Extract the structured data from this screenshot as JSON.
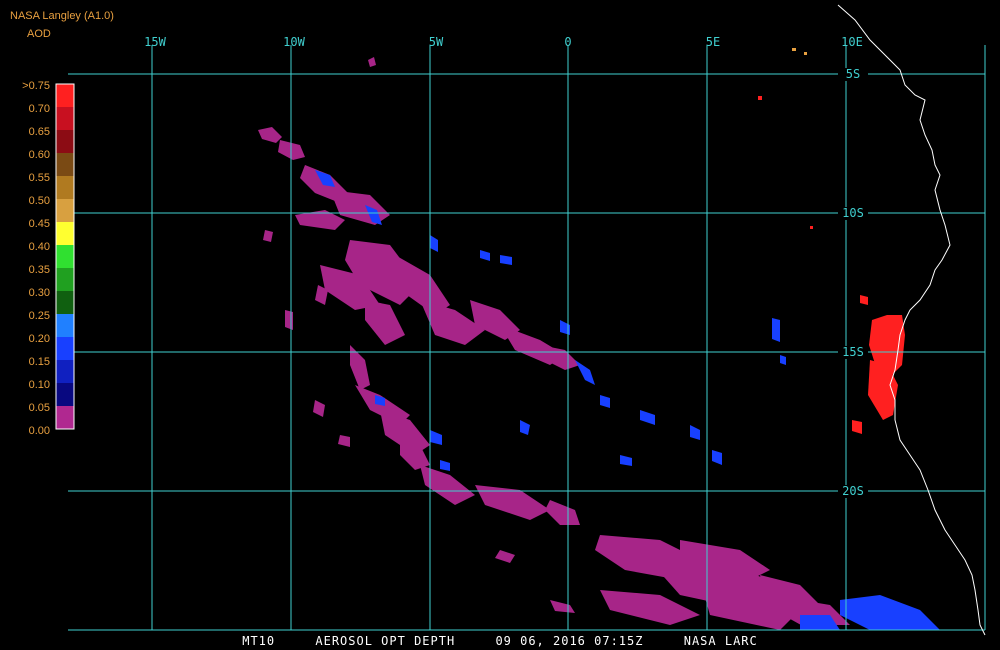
{
  "header": {
    "source": "NASA Langley (A1.0)",
    "product": "AOD"
  },
  "colorbar": {
    "labels": [
      ">0.75",
      "0.70",
      "0.65",
      "0.60",
      "0.55",
      "0.50",
      "0.45",
      "0.40",
      "0.35",
      "0.30",
      "0.25",
      "0.20",
      "0.15",
      "0.10",
      "0.05",
      "0.00"
    ],
    "colors": [
      "#ff2020",
      "#c81020",
      "#8c0c14",
      "#7a4a14",
      "#b07a20",
      "#d8a040",
      "#ffff30",
      "#30e030",
      "#20a020",
      "#106010",
      "#2080ff",
      "#1840ff",
      "#1020c0",
      "#080880",
      "#b02890"
    ]
  },
  "map": {
    "lon_labels": [
      "15W",
      "10W",
      "5W",
      "0",
      "5E",
      "10E"
    ],
    "lat_labels": [
      "5S",
      "10S",
      "15S",
      "20S"
    ],
    "grid_color": "#40d0d0",
    "coast_color": "#ffffff"
  },
  "footer": {
    "platform": "MT10",
    "parameter": "AEROSOL OPT DEPTH",
    "datetime": "09 06, 2016 07:15Z",
    "credit": "NASA LARC"
  }
}
